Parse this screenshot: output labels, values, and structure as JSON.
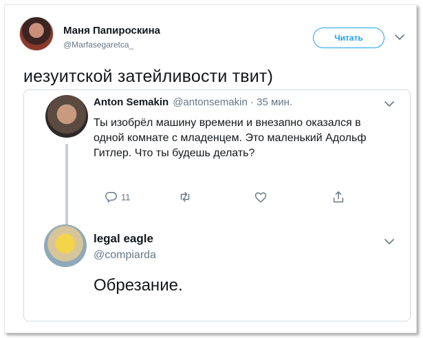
{
  "main_tweet": {
    "author_name": "Маня Папироскина",
    "author_handle": "@Marfasegaretca_",
    "follow_label": "Читать",
    "text": "иезуитской затейливости твит)"
  },
  "quoted_thread": {
    "first": {
      "author_name": "Anton Semakin",
      "meta": "@antonsemakin · 35 мин.",
      "text": "Ты изобрёл машину времени и внезапно оказался в одной комнате с младенцем. Это маленький Адольф Гитлер. Что ты будешь делать?",
      "reply_count": "11",
      "icons": [
        "reply-icon",
        "retweet-icon",
        "like-icon",
        "share-icon"
      ]
    },
    "second": {
      "author_name": "legal eagle",
      "author_handle": "@compiarda",
      "text": "Обрезание."
    }
  },
  "colors": {
    "accent": "#1da1f2",
    "text": "#14171a",
    "muted": "#657786",
    "border": "#d4dadf"
  }
}
